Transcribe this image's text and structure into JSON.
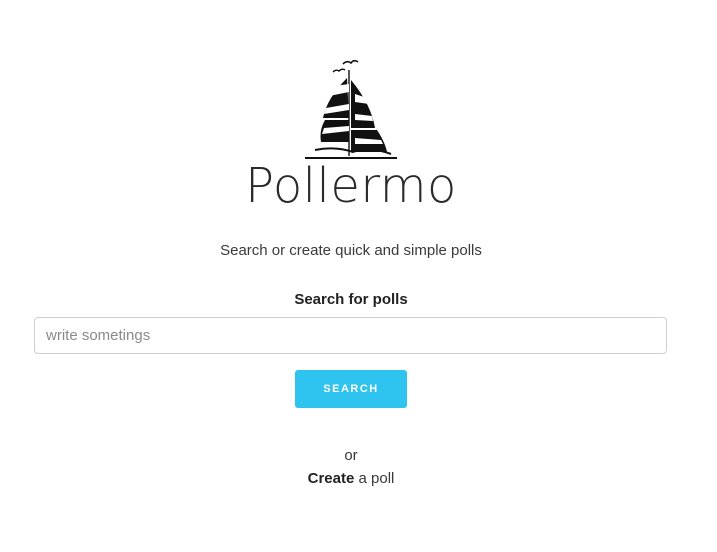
{
  "brand": {
    "name": "Pollermo",
    "logo_icon": "sailboat-icon"
  },
  "tagline": "Search or create quick and simple polls",
  "search": {
    "label": "Search for polls",
    "placeholder": "write sometings",
    "value": "",
    "button_label": "SEARCH",
    "button_color": "#2fc3ef"
  },
  "footer": {
    "or": "or",
    "create_link": "Create",
    "create_suffix": " a poll"
  }
}
